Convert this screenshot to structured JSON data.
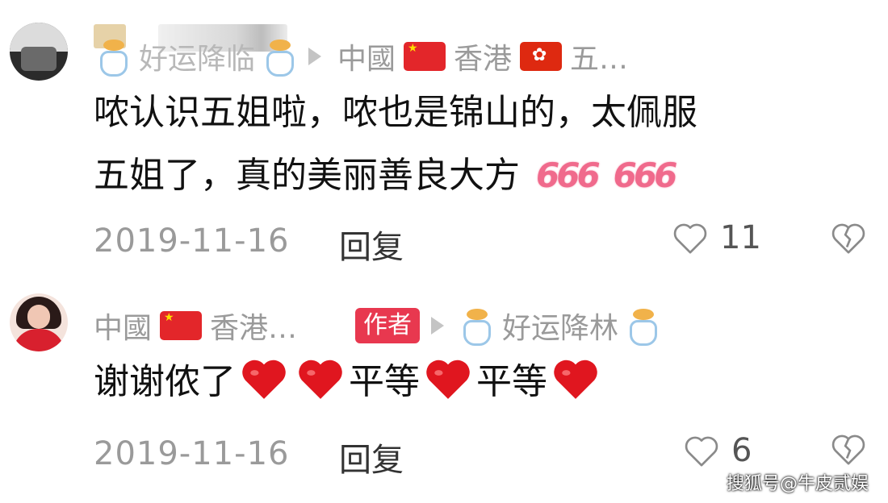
{
  "comments": [
    {
      "username": "好运降临",
      "location": "中國",
      "location2": "香港",
      "location3": "五…",
      "text_line1": "哝认识五姐啦，哝也是锦山的，太佩服",
      "text_line2": "五姐了，真的美丽善良大方",
      "emoji_text": "666",
      "date": "2019-11-16",
      "reply_label": "回复",
      "likes": "11"
    },
    {
      "location": "中國",
      "location2": "香港…",
      "author_badge": "作者",
      "reply_to": "好运降林",
      "text_part1": "谢谢侬了",
      "text_part2": "平等",
      "text_part3": "平等",
      "date": "2019-11-16",
      "reply_label": "回复",
      "likes": "6"
    }
  ],
  "watermark": "搜狐号@牛皮贰娱",
  "icons": {
    "like": "heart-outline-icon",
    "dislike": "broken-heart-icon",
    "reply_arrow": "play-triangle-icon",
    "heart_emoji": "red-heart-emoji"
  },
  "colors": {
    "meta": "#9a9a9a",
    "author_badge": "#e8384f",
    "heart": "#e0161f"
  }
}
